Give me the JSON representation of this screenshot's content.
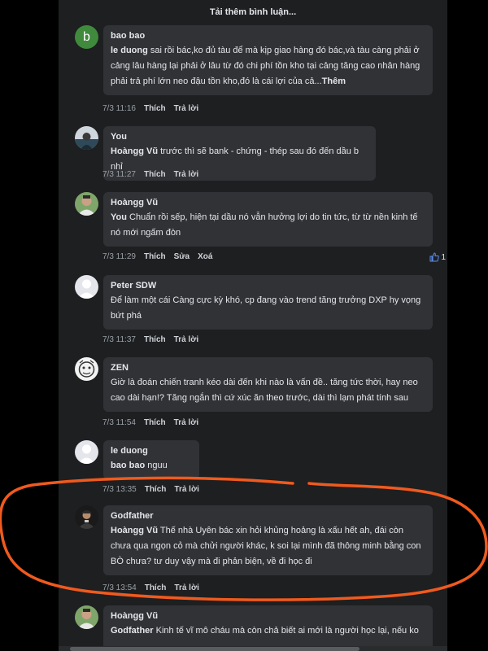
{
  "load_more": "Tải thêm bình luận...",
  "colors": {
    "background": "#1e1f21",
    "bubble": "#313236",
    "annotation": "#f05a1e",
    "avatar_b": "#3f8a3c"
  },
  "comments": [
    {
      "author": "bao bao",
      "mention": "le duong",
      "body": " sai rồi bác,ko đủ tàu để mà kịp giao hàng đó bác,và tàu càng phải ở cảng lâu hàng lại phải ở lâu từ đó chi phí tồn kho tại cảng tăng cao nhân hàng phải trả phí lớn neo đậu tồn kho,đó là cái lợi của cả...",
      "more": "Thêm",
      "time": "7/3 11:16",
      "like": "Thích",
      "reply": "Trả lời",
      "avatar_letter": "b"
    },
    {
      "author": "You",
      "mention": "Hoàngg Vũ",
      "body": " trước thì sẽ bank - chứng - thép sau đó đến dầu b nhỉ",
      "time": "7/3 11:27",
      "like": "Thích",
      "reply": "Trả lời"
    },
    {
      "author": "Hoàngg Vũ",
      "mention": "You",
      "body": " Chuẩn rồi sếp, hiện tại dầu nó vẫn hưởng lợi do tin tức, từ từ nền kinh tế nó mới ngấm đòn",
      "time": "7/3 11:29",
      "like": "Thích",
      "edit": "Sửa",
      "delete": "Xoá",
      "like_count": "1"
    },
    {
      "author": "Peter SDW",
      "body": "Để làm một cái Càng cực kỳ khó, cp đang vào trend tăng trưởng DXP hy vọng bứt phá",
      "time": "7/3 11:37",
      "like": "Thích",
      "reply": "Trả lời"
    },
    {
      "author": "ZEN",
      "body": "Giờ là đoán chiến tranh kéo dài đến khi nào là vấn đề.. tăng tức thời, hay neo cao dài hạn!? Tăng ngắn thì cứ xúc ăn theo trước, dài thì lạm phát tính sau",
      "time": "7/3 11:54",
      "like": "Thích",
      "reply": "Trả lời"
    },
    {
      "author": "le duong",
      "mention": "bao bao",
      "body": " nguu",
      "time": "7/3 13:35",
      "like": "Thích",
      "reply": "Trả lời"
    },
    {
      "author": "Godfather",
      "mention": "Hoàngg Vũ",
      "body": " Thế nhà Uyên bác xin hỏi khủng hoảng là xấu hết ah, đái còn chưa qua ngọn cỏ mà chửi người khác, k soi lại mình đã thông minh bằng con BÒ chưa? tư duy vậy mà đi phản biện, về đi học đi",
      "time": "7/3 13:54",
      "like": "Thích",
      "reply": "Trả lời"
    },
    {
      "author": "Hoàngg Vũ",
      "mention": "Godfather",
      "body": " Kinh tế vĩ mô cháu mà còn chả biết ai mới là người học lại, nếu ko"
    }
  ]
}
